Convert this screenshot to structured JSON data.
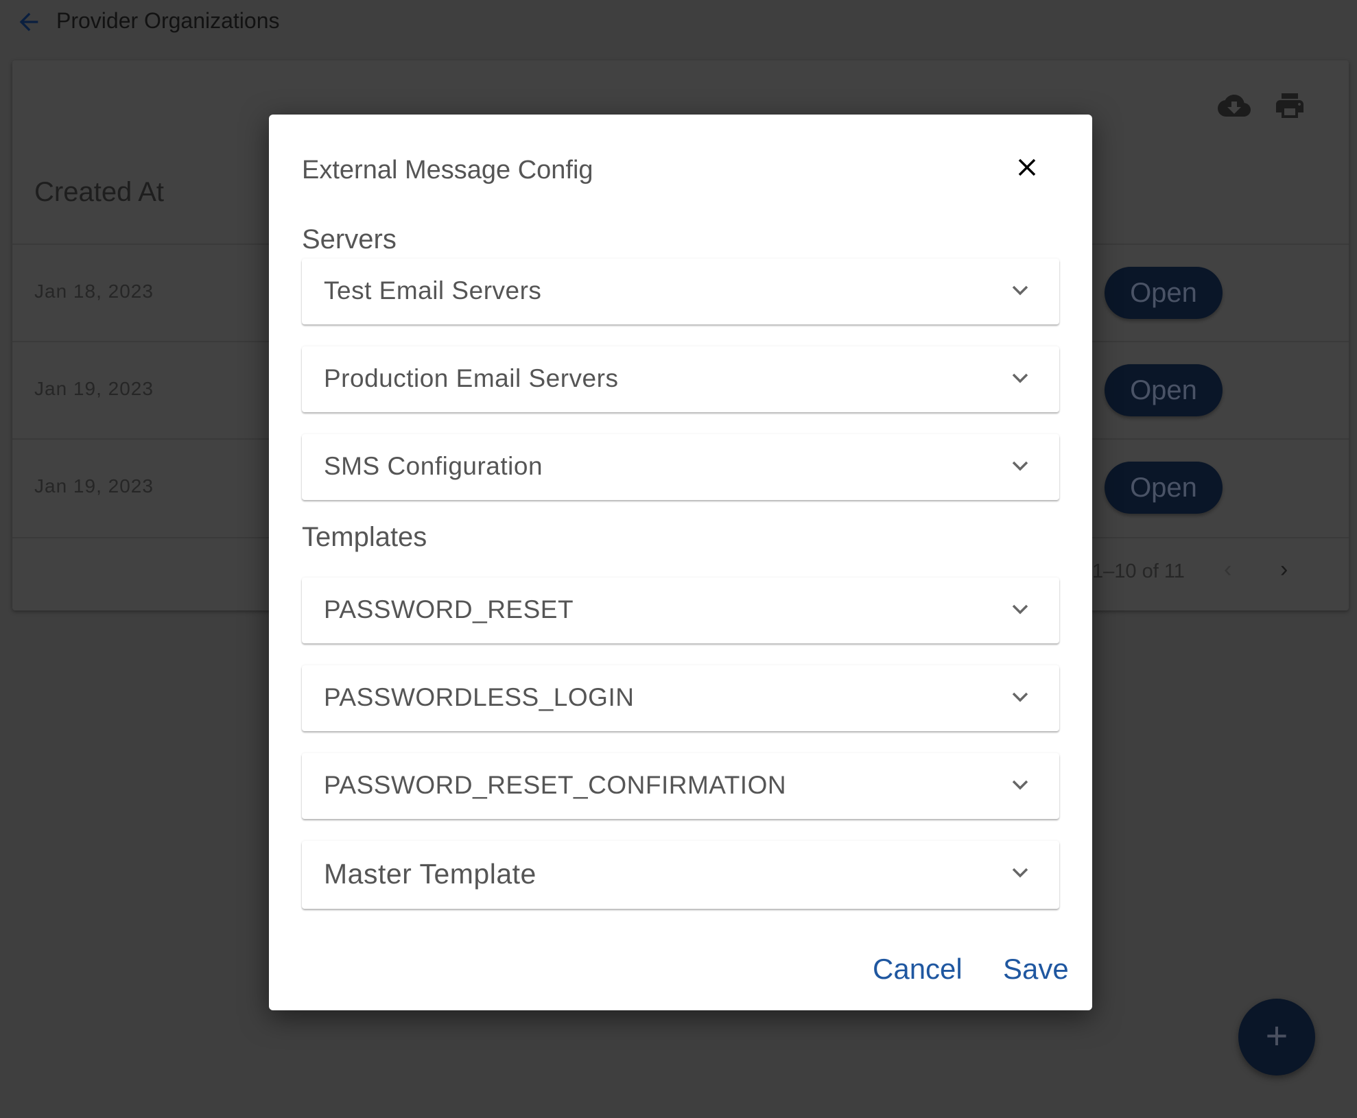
{
  "header": {
    "title": "Provider Organizations",
    "back_icon": "arrow-left-icon"
  },
  "toolbar": {
    "download_icon": "cloud-download-icon",
    "print_icon": "printer-icon"
  },
  "table": {
    "column": "Created At",
    "rows": [
      {
        "created_at": "Jan 18, 2023",
        "action": "Open"
      },
      {
        "created_at": "Jan 19, 2023",
        "action": "Open"
      },
      {
        "created_at": "Jan 19, 2023",
        "action": "Open"
      }
    ],
    "pagination": {
      "range": "1–10 of 11",
      "prev": "‹",
      "next": "›"
    }
  },
  "fab": {
    "label": "+"
  },
  "dialog": {
    "title": "External Message Config",
    "servers_heading": "Servers",
    "servers": [
      "Test Email Servers",
      "Production Email Servers",
      "SMS Configuration"
    ],
    "templates_heading": "Templates",
    "templates": [
      "PASSWORD_RESET",
      "PASSWORDLESS_LOGIN",
      "PASSWORD_RESET_CONFIRMATION",
      "Master Template"
    ],
    "cancel": "Cancel",
    "save": "Save"
  },
  "colors": {
    "accent": "#1f57a0",
    "primary": "#0b2a5c"
  }
}
